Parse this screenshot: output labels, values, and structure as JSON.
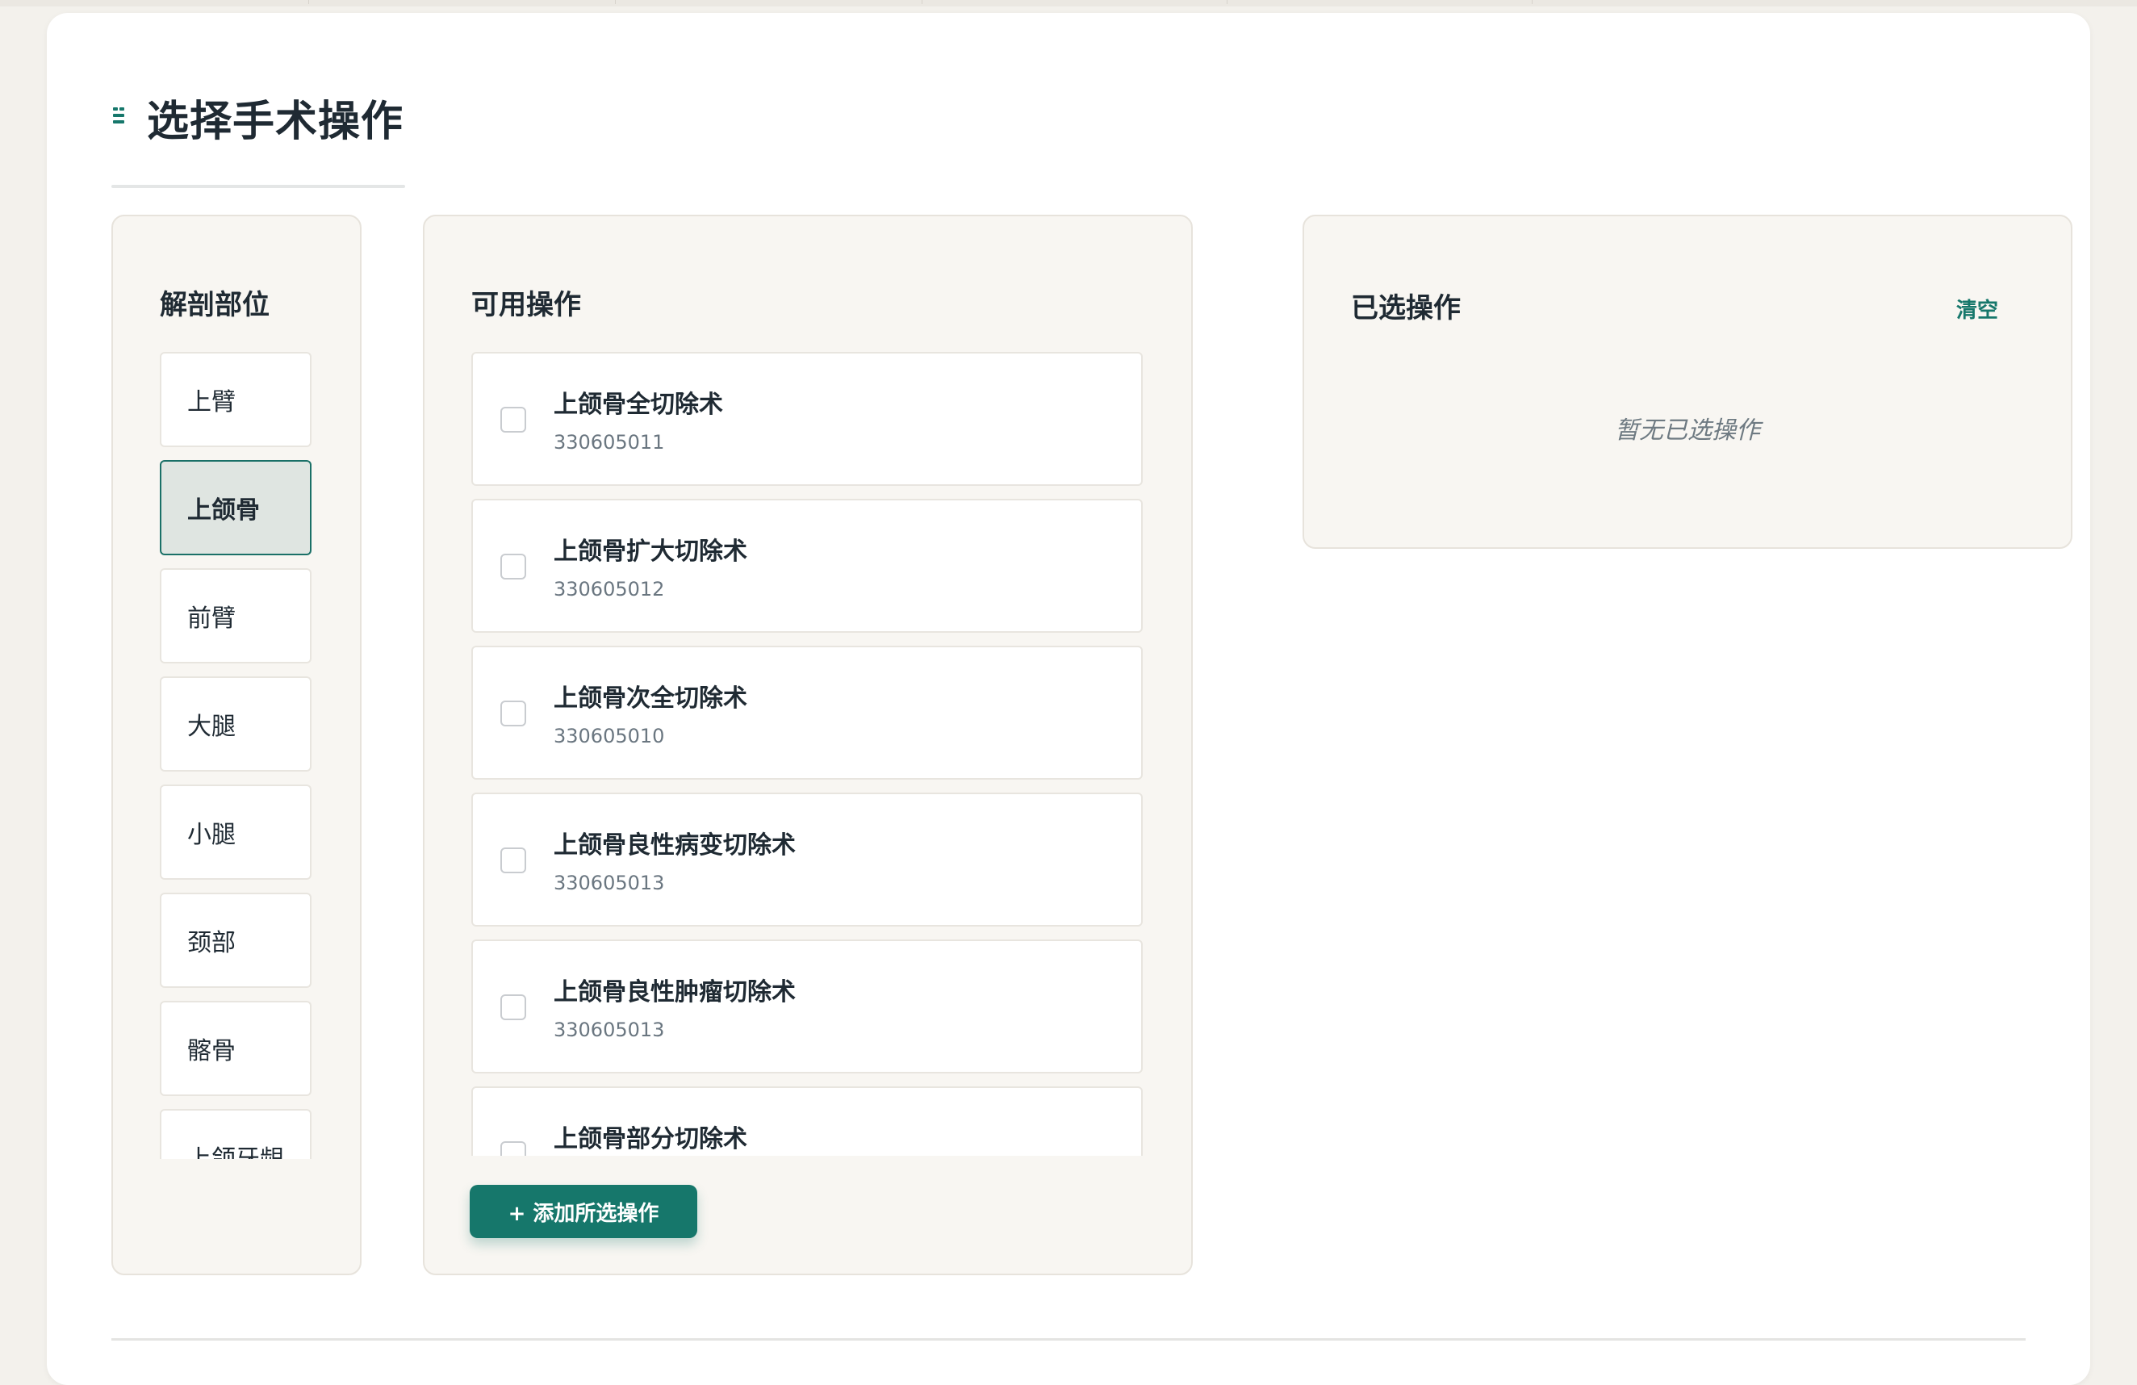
{
  "page": {
    "title": "选择手术操作"
  },
  "anatomy": {
    "title": "解剖部位",
    "items": [
      {
        "label": "上臂"
      },
      {
        "label": "上颌骨"
      },
      {
        "label": "前臂"
      },
      {
        "label": "大腿"
      },
      {
        "label": "小腿"
      },
      {
        "label": "颈部"
      },
      {
        "label": "髂骨"
      },
      {
        "label": "上颌牙龈"
      }
    ],
    "selected": "上颌骨"
  },
  "available": {
    "title": "可用操作",
    "items": [
      {
        "name": "上颌骨全切除术",
        "code": "330605011"
      },
      {
        "name": "上颌骨扩大切除术",
        "code": "330605012"
      },
      {
        "name": "上颌骨次全切除术",
        "code": "330605010"
      },
      {
        "name": "上颌骨良性病变切除术",
        "code": "330605013"
      },
      {
        "name": "上颌骨良性肿瘤切除术",
        "code": "330605013"
      },
      {
        "name": "上颌骨部分切除术",
        "code": ""
      }
    ],
    "add_button": "+ 添加所选操作"
  },
  "selected": {
    "title": "已选操作",
    "clear_label": "清空",
    "empty_text": "暂无已选操作"
  },
  "colors": {
    "accent": "#16776b",
    "panel_bg": "#f8f6f2",
    "active_bg": "#dfe5e1"
  }
}
